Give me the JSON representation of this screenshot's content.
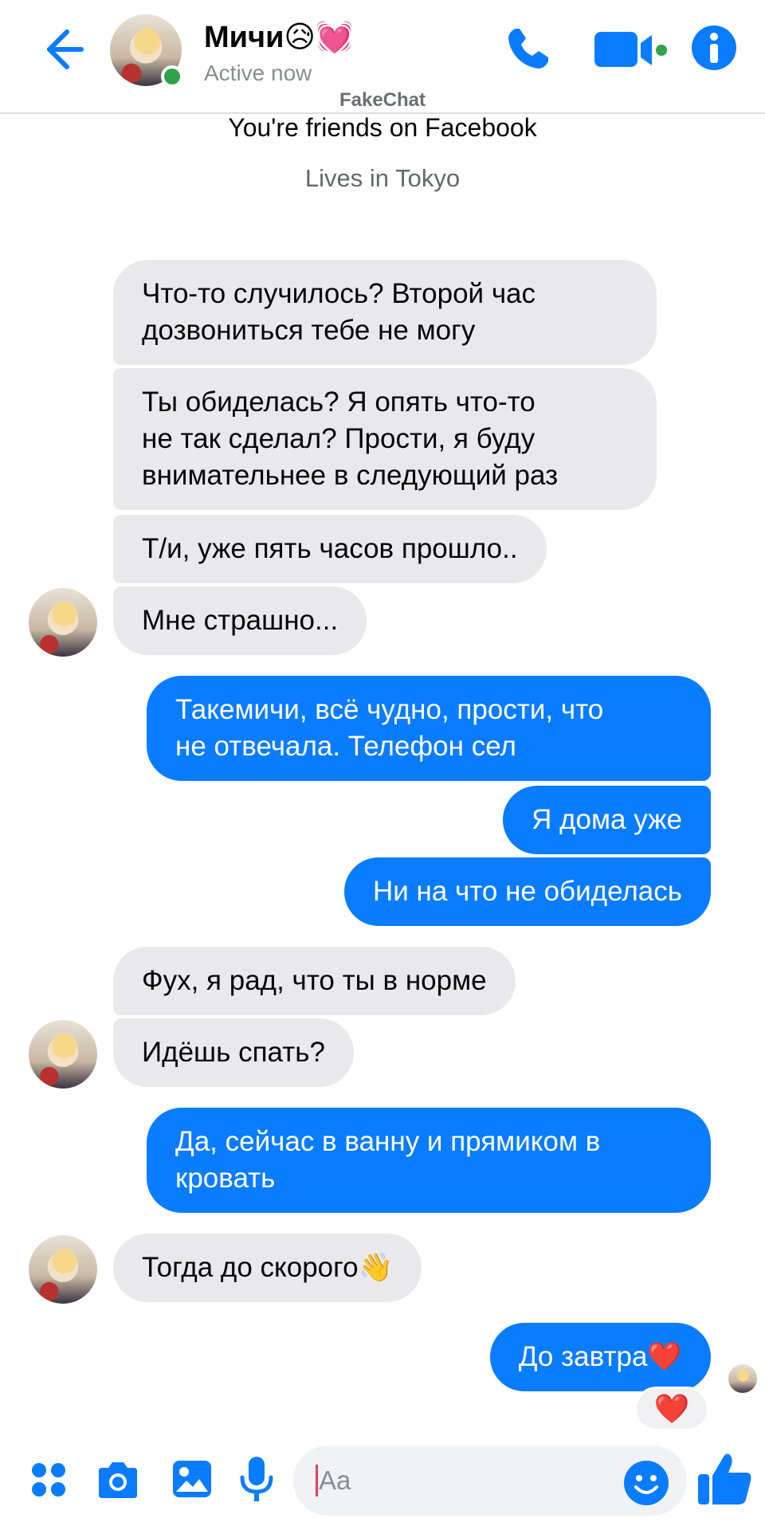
{
  "colors": {
    "accent": "#0a7cff",
    "incoming_bubble": "#e9e9eb",
    "online": "#31a24c",
    "status_text": "#8a8d91"
  },
  "header": {
    "contact_name": "Мичи😥💓",
    "status": "Active now",
    "icons": [
      "back-arrow-icon",
      "phone-icon",
      "video-camera-icon",
      "info-icon"
    ]
  },
  "watermark": "FakeChat",
  "intro": {
    "friends": "You're friends on Facebook",
    "location": "Lives in Tokyo"
  },
  "messages": [
    {
      "from": "them",
      "text": "Что-то случилось? Второй час\nдозвониться тебе не могу"
    },
    {
      "from": "them",
      "text": "Ты обиделась? Я опять что-то\nне так сделал? Прости, я буду\nвнимательнее в следующий раз"
    },
    {
      "from": "them",
      "text": "Т/и, уже пять часов прошло.."
    },
    {
      "from": "them",
      "text": "Мне страшно..."
    },
    {
      "from": "me",
      "text": "Такемичи, всё чудно, прости, что\nне отвечала. Телефон сел"
    },
    {
      "from": "me",
      "text": "Я дома уже"
    },
    {
      "from": "me",
      "text": "Ни на что не обиделась"
    },
    {
      "from": "them",
      "text": "Фух, я рад, что ты в норме"
    },
    {
      "from": "them",
      "text": "Идёшь спать?"
    },
    {
      "from": "me",
      "text": "Да, сейчас в ванну и прямиком в\nкровать"
    },
    {
      "from": "them",
      "text": "Тогда до скорого👋"
    },
    {
      "from": "me",
      "text": "До завтра❤️",
      "reaction": "❤️"
    }
  ],
  "composer": {
    "placeholder": "Aa",
    "icons": [
      "apps-icon",
      "camera-icon",
      "gallery-icon",
      "microphone-icon",
      "emoji-icon",
      "thumbs-up-icon"
    ]
  }
}
